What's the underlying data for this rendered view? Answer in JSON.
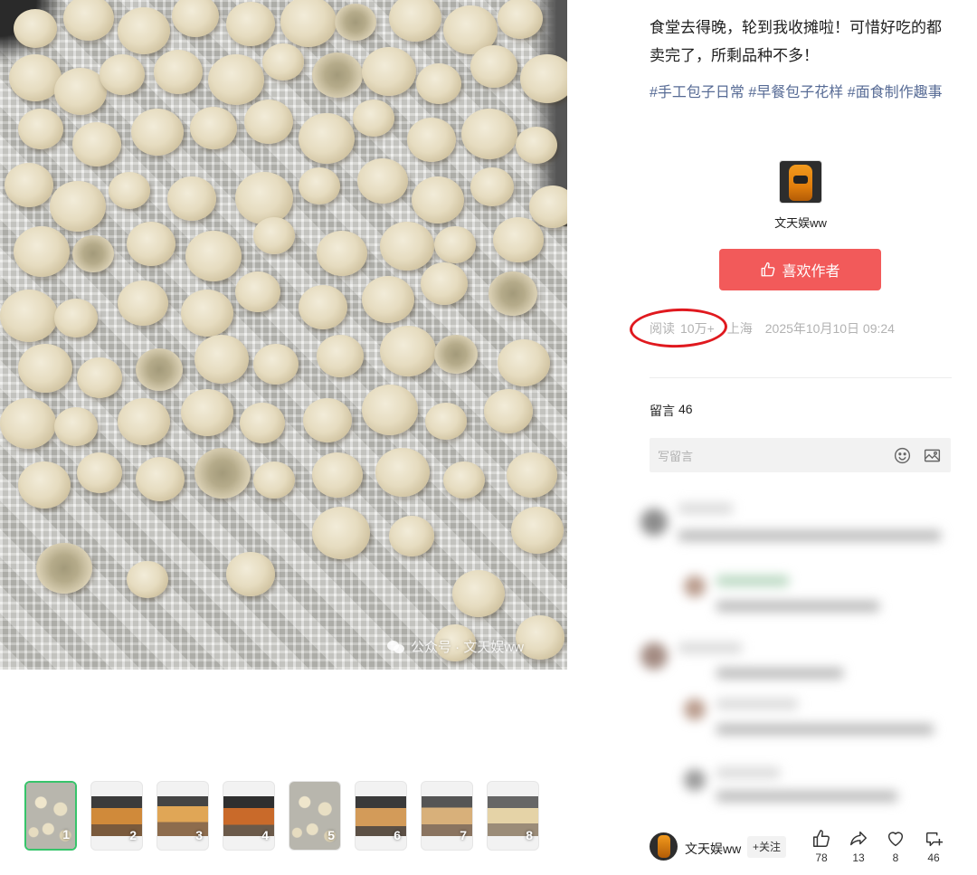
{
  "post": {
    "text": "食堂去得晚，轮到我收摊啦！可惜好吃的都卖完了，所剩品种不多！",
    "tags": [
      "#手工包子日常",
      "#早餐包子花样",
      "#面食制作趣事"
    ]
  },
  "photo": {
    "watermark": "公众号 · 文天娱ww"
  },
  "thumbnails": [
    {
      "num": "1",
      "active": true
    },
    {
      "num": "2",
      "active": false
    },
    {
      "num": "3",
      "active": false
    },
    {
      "num": "4",
      "active": false
    },
    {
      "num": "5",
      "active": false
    },
    {
      "num": "6",
      "active": false
    },
    {
      "num": "7",
      "active": false
    },
    {
      "num": "8",
      "active": false
    }
  ],
  "author": {
    "name": "文天娱ww",
    "like_author_label": "喜欢作者"
  },
  "meta": {
    "read_label": "阅读",
    "read_count": "10万+",
    "location": "上海",
    "datetime": "2025年10月10日 09:24"
  },
  "comments": {
    "title": "留言",
    "count": "46",
    "input_placeholder": "写留言"
  },
  "bottom_bar": {
    "author_name": "文天娱ww",
    "follow_label": "+关注",
    "like_count": "78",
    "share_count": "13",
    "favorite_count": "8",
    "comment_count": "46"
  },
  "colors": {
    "accent_red": "#f25a5a",
    "tag_blue": "#576b95",
    "thumbnail_active": "#37c46b",
    "highlight_circle": "#e0191f"
  }
}
